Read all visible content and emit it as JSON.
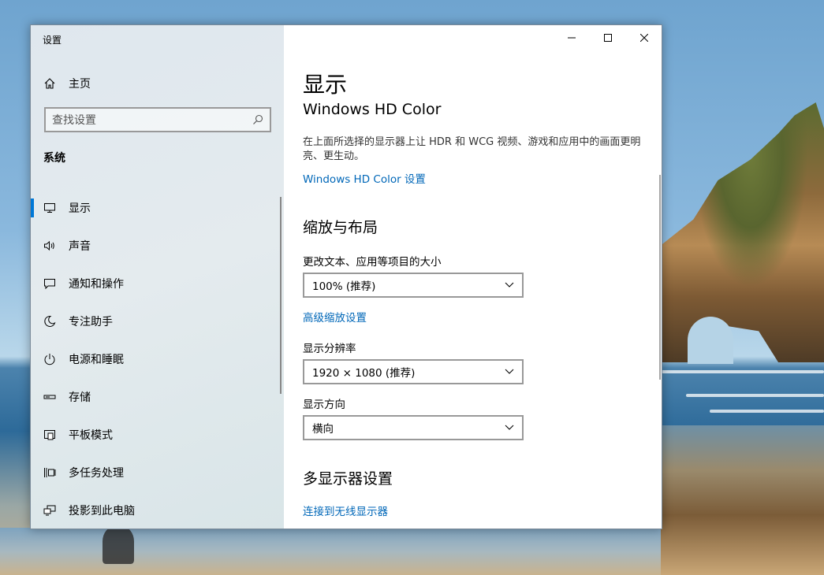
{
  "window": {
    "title": "设置"
  },
  "sidebar": {
    "home_label": "主页",
    "search_placeholder": "查找设置",
    "section_label": "系统",
    "items": [
      {
        "label": "显示",
        "icon": "monitor-icon",
        "active": true
      },
      {
        "label": "声音",
        "icon": "speaker-icon"
      },
      {
        "label": "通知和操作",
        "icon": "notification-icon"
      },
      {
        "label": "专注助手",
        "icon": "moon-icon"
      },
      {
        "label": "电源和睡眠",
        "icon": "power-icon"
      },
      {
        "label": "存储",
        "icon": "storage-icon"
      },
      {
        "label": "平板模式",
        "icon": "tablet-mode-icon"
      },
      {
        "label": "多任务处理",
        "icon": "multitasking-icon"
      },
      {
        "label": "投影到此电脑",
        "icon": "project-icon"
      }
    ]
  },
  "main": {
    "page_title": "显示",
    "hdr": {
      "heading": "Windows HD Color",
      "description": "在上面所选择的显示器上让 HDR 和 WCG 视频、游戏和应用中的画面更明亮、更生动。",
      "settings_link": "Windows HD Color 设置"
    },
    "scale": {
      "heading": "缩放与布局",
      "text_size_label": "更改文本、应用等项目的大小",
      "text_size_value": "100% (推荐)",
      "advanced_link": "高级缩放设置",
      "resolution_label": "显示分辨率",
      "resolution_value": "1920 × 1080 (推荐)",
      "orientation_label": "显示方向",
      "orientation_value": "横向"
    },
    "multi": {
      "heading": "多显示器设置",
      "wireless_link": "连接到无线显示器"
    }
  },
  "colors": {
    "accent": "#0078d7",
    "link": "#0067b8"
  }
}
